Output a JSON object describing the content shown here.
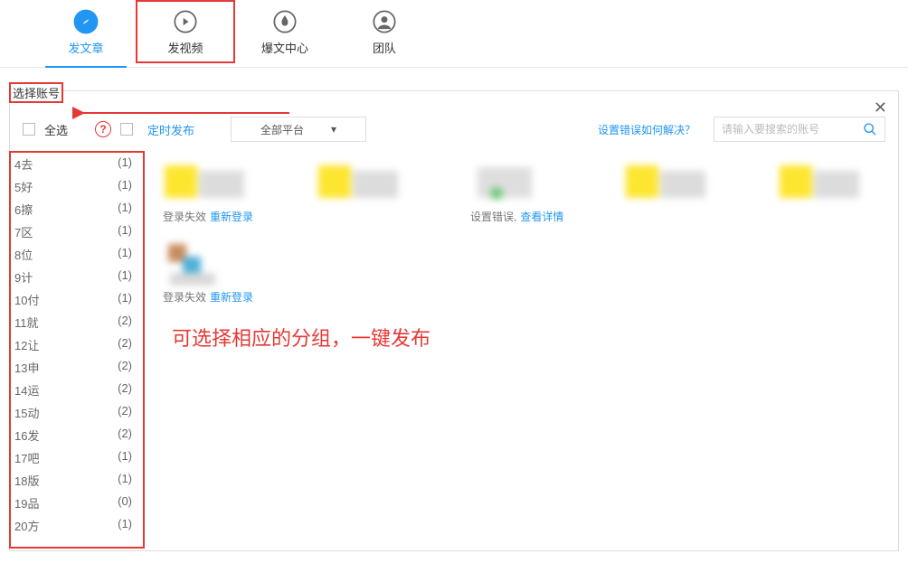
{
  "tabs": [
    {
      "label": "发文章"
    },
    {
      "label": "发视频"
    },
    {
      "label": "爆文中心"
    },
    {
      "label": "团队"
    }
  ],
  "panel_title": "选择账号",
  "toolbar": {
    "select_all": "全选",
    "scheduled": "定时发布",
    "platform": "全部平台",
    "error_link": "设置错误如何解决？",
    "search_placeholder": "请输入要搜索的账号"
  },
  "groups": [
    {
      "name": "4去",
      "count": "(1)"
    },
    {
      "name": "5好",
      "count": "(1)"
    },
    {
      "name": "6擦",
      "count": "(1)"
    },
    {
      "name": "7区",
      "count": "(1)"
    },
    {
      "name": "8位",
      "count": "(1)"
    },
    {
      "name": "9计",
      "count": "(1)"
    },
    {
      "name": "10付",
      "count": "(1)"
    },
    {
      "name": "11就",
      "count": "(2)"
    },
    {
      "name": "12让",
      "count": "(2)"
    },
    {
      "name": "13申",
      "count": "(2)"
    },
    {
      "name": "14运",
      "count": "(2)"
    },
    {
      "name": "15动",
      "count": "(2)"
    },
    {
      "name": "16发",
      "count": "(2)"
    },
    {
      "name": "17吧",
      "count": "(1)"
    },
    {
      "name": "18版",
      "count": "(1)"
    },
    {
      "name": "19品",
      "count": "(0)"
    },
    {
      "name": "20方",
      "count": "(1)"
    }
  ],
  "accounts": [
    {
      "status": "登录失效",
      "action": "重新登录"
    },
    {
      "status": "",
      "action": ""
    },
    {
      "status": "设置错误,",
      "action": "查看详情"
    },
    {
      "status": "",
      "action": ""
    },
    {
      "status": "",
      "action": ""
    },
    {
      "status": "登录失效",
      "action": "重新登录"
    }
  ],
  "hint": "可选择相应的分组，一键发布"
}
